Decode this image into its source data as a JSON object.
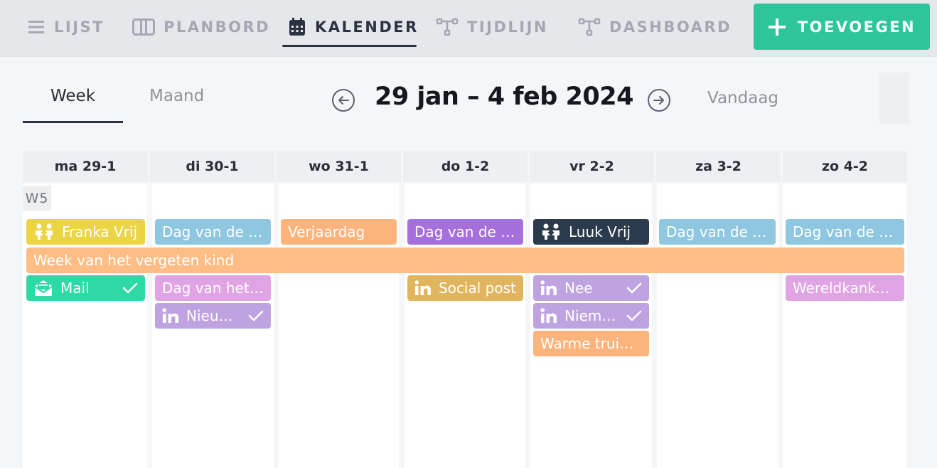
{
  "nav": {
    "tabs": [
      {
        "label": "LIJST",
        "icon": "list-icon"
      },
      {
        "label": "PLANBORD",
        "icon": "board-icon"
      },
      {
        "label": "KALENDER",
        "icon": "calendar-icon"
      },
      {
        "label": "TIJDLIJN",
        "icon": "timeline-icon"
      },
      {
        "label": "DASHBOARD",
        "icon": "dashboard-icon"
      }
    ],
    "active": "KALENDER",
    "add_label": "TOEVOEGEN"
  },
  "view": {
    "tabs": [
      "Week",
      "Maand"
    ],
    "active": "Week",
    "range": "29 jan – 4 feb 2024",
    "today_label": "Vandaag"
  },
  "calendar": {
    "days": [
      "ma 29-1",
      "di 30-1",
      "wo 31-1",
      "do 1-2",
      "vr 2-2",
      "za 3-2",
      "zo 4-2"
    ],
    "week_badge": "W5",
    "events": [
      {
        "label": "Franka Vrij",
        "icon": "people-icon",
        "color": "#ecd544"
      },
      {
        "label": "Dag van de Rolstoel",
        "color": "#8fc7e0"
      },
      {
        "label": "Verjaardag",
        "color": "#fdb47c"
      },
      {
        "label": "Dag van de Zorg",
        "color": "#a56fdc"
      },
      {
        "label": "Luuk Vrij",
        "icon": "people-icon",
        "color": "#2b3a4c"
      },
      {
        "label": "Dag van de Vrouw",
        "color": "#8fc7e0"
      },
      {
        "label": "Dag van de Zon",
        "color": "#8fc7e0"
      },
      {
        "label": "Week van het vergeten kind",
        "color": "#fdbd85"
      },
      {
        "label": "Mail",
        "icon": "mail-icon",
        "check": true,
        "color": "#2ed9a6"
      },
      {
        "label": "Dag van het Gedicht",
        "color": "#e0a4e4"
      },
      {
        "label": "Nieuwsbericht",
        "icon": "linkedin-icon",
        "check": true,
        "color": "#bfa3e1"
      },
      {
        "label": "Social post",
        "icon": "linkedin-icon",
        "color": "#e1b55e"
      },
      {
        "label": "Nee",
        "icon": "linkedin-icon",
        "check": true,
        "color": "#bfa3e1"
      },
      {
        "label": "Niemand",
        "icon": "linkedin-icon",
        "check": true,
        "color": "#bfa3e1"
      },
      {
        "label": "Warme truiendag",
        "color": "#fdb47c"
      },
      {
        "label": "Wereldkankerdag",
        "color": "#e0a4e4"
      }
    ]
  }
}
